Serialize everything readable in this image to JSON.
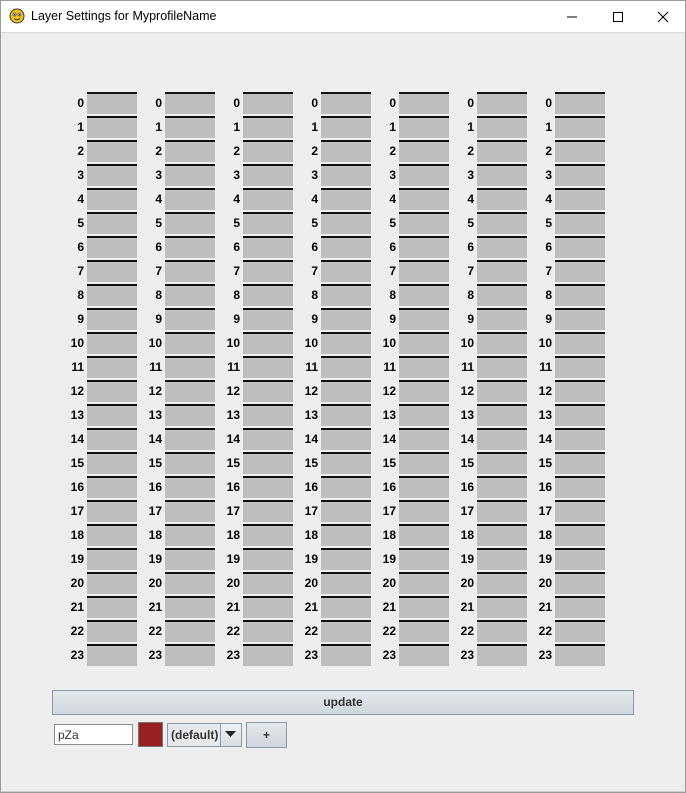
{
  "window": {
    "title": "Layer Settings for MyprofileName",
    "controls": [
      "minimize-icon",
      "maximize-icon",
      "close-icon"
    ]
  },
  "layers": {
    "column_count": 7,
    "row_labels": [
      "0",
      "1",
      "2",
      "3",
      "4",
      "5",
      "6",
      "7",
      "8",
      "9",
      "10",
      "11",
      "12",
      "13",
      "14",
      "15",
      "16",
      "17",
      "18",
      "19",
      "20",
      "21",
      "22",
      "23"
    ],
    "cell_color": "#bebebe"
  },
  "update_button": {
    "label": "update"
  },
  "footer": {
    "name_input_value": "pZa",
    "color": "#972020",
    "style_select": {
      "selected": "(default)"
    },
    "add_button_label": "+"
  }
}
